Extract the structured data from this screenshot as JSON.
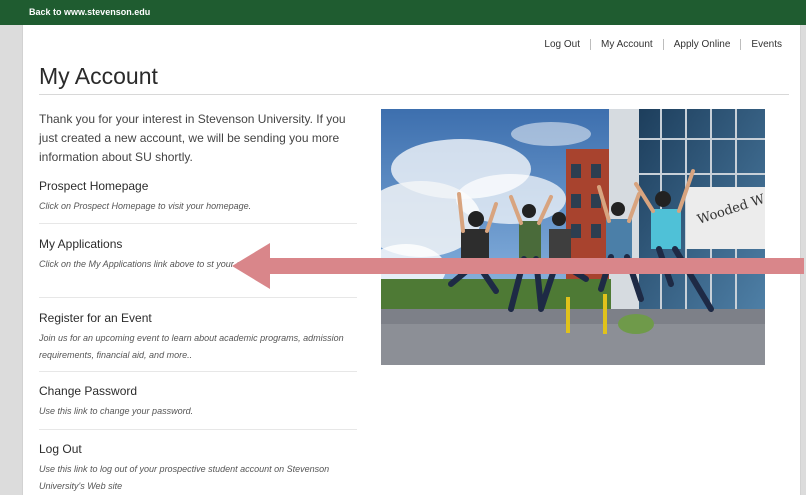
{
  "topbar": {
    "back_link": "Back to www.stevenson.edu"
  },
  "nav": {
    "logout": "Log Out",
    "my_account": "My Account",
    "apply_online": "Apply Online",
    "events": "Events"
  },
  "page": {
    "title": "My Account",
    "intro": "Thank you for your interest in Stevenson University. If you just created a new account, we will be sending you more information about SU shortly."
  },
  "items": [
    {
      "title": "Prospect Homepage",
      "desc": "Click on Prospect Homepage to visit your homepage."
    },
    {
      "title": "My Applications",
      "desc": "Click on the My Applications link above to st your application for admission."
    },
    {
      "title": "Register for an Event",
      "desc": "Join us for an upcoming event to learn about academic programs, admission requirements, financial aid, and more.."
    },
    {
      "title": "Change Password",
      "desc": "Use this link to change your password."
    },
    {
      "title": "Log Out",
      "desc": "Use this link to log out of your prospective student account on Stevenson University's Web site"
    }
  ],
  "photo": {
    "sign_text": "Wooded W"
  },
  "colors": {
    "brand_green": "#1f5c30",
    "arrow": "#d9868a"
  }
}
